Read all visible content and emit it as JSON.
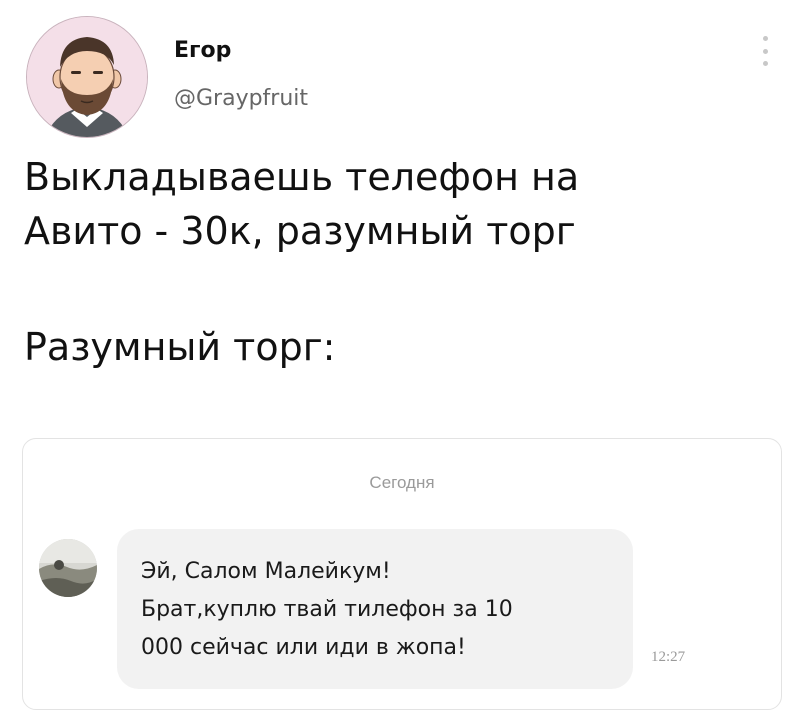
{
  "author": {
    "name": "Егор",
    "handle": "@Graypfruit"
  },
  "tweet": {
    "lines": [
      "Выкладываешь телефон на",
      "Авито - 30к, разумный торг"
    ],
    "second_line": "Разумный торг:"
  },
  "chat": {
    "date_label": "Сегодня",
    "message_lines": [
      "Эй, Салом Малейкум!",
      "Брат,куплю твай тилефон за 10",
      "000 сейчас или иди в жопа!"
    ],
    "time": "12:27"
  },
  "icons": {
    "more": "more-vertical-icon"
  },
  "colors": {
    "text": "#111111",
    "muted": "#666666",
    "bubble": "#f2f2f2",
    "card_border": "#e3e3e3"
  }
}
